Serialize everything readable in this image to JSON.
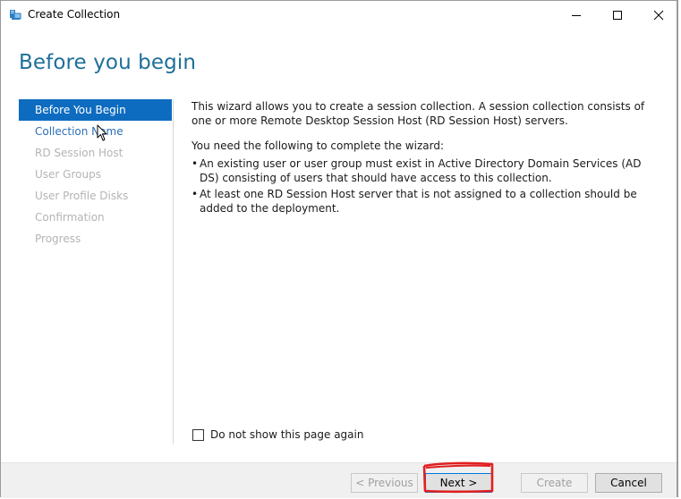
{
  "window": {
    "title": "Create Collection"
  },
  "header": {
    "title": "Before you begin"
  },
  "nav": {
    "items": [
      {
        "label": "Before You Begin",
        "state": "active"
      },
      {
        "label": "Collection Name",
        "state": "link"
      },
      {
        "label": "RD Session Host",
        "state": "disabled"
      },
      {
        "label": "User Groups",
        "state": "disabled"
      },
      {
        "label": "User Profile Disks",
        "state": "disabled"
      },
      {
        "label": "Confirmation",
        "state": "disabled"
      },
      {
        "label": "Progress",
        "state": "disabled"
      }
    ]
  },
  "main": {
    "intro": "This wizard allows you to create a session collection. A session collection consists of one or more Remote Desktop Session Host (RD Session Host) servers.",
    "requirements_heading": "You need the following to complete the wizard:",
    "bullets": [
      "An existing user or user group must exist in Active Directory Domain Services (AD DS) consisting of users that should have access to this collection.",
      "At least one RD Session Host server that is not assigned to a collection should be added to the deployment."
    ],
    "bullet_glyph": "•",
    "checkbox_label": "Do not show this page again"
  },
  "footer": {
    "previous_label": "< Previous",
    "next_label": "Next >",
    "create_label": "Create",
    "cancel_label": "Cancel"
  },
  "colors": {
    "accent": "#0e6cc0",
    "header_text": "#1e6f9a",
    "link": "#2a6fb7",
    "annotation": "#e02020"
  },
  "icons": {
    "app": "server-collection-icon",
    "minimize": "minimize-icon",
    "maximize": "maximize-icon",
    "close": "close-icon"
  }
}
